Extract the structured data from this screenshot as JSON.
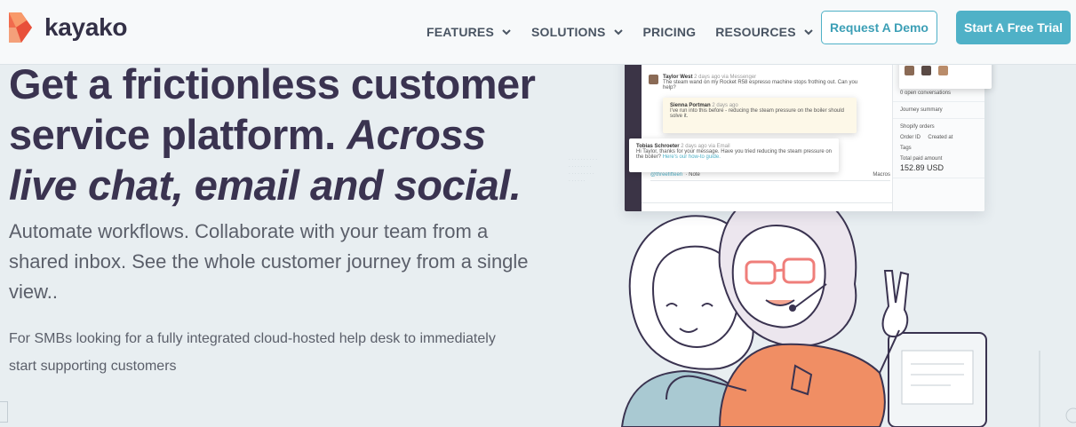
{
  "brand": {
    "name": "kayako"
  },
  "nav": {
    "items": [
      {
        "label": "FEATURES",
        "has_dropdown": true
      },
      {
        "label": "SOLUTIONS",
        "has_dropdown": true
      },
      {
        "label": "PRICING",
        "has_dropdown": false
      },
      {
        "label": "RESOURCES",
        "has_dropdown": true
      }
    ],
    "demo_button": "Request A Demo",
    "trial_button": "Start A Free Trial"
  },
  "hero": {
    "title_plain": "Get a frictionless customer service platform.",
    "title_italic": "Across live chat, email and social.",
    "subtitle": "Automate workflows. Collaborate with your team from a shared inbox. See the whole customer journey from a single view..",
    "note": "For SMBs looking for a fully integrated cloud-hosted help desk to immediately start supporting customers"
  },
  "mockup": {
    "msg1_name": "Taylor West",
    "msg1_meta": "2 days ago via Messenger",
    "msg1_text": "The steam wand on my Rocket R58 espresso machine stops frothing out. Can you help?",
    "msg2_name": "Sienna Portman",
    "msg2_meta": "2 days ago",
    "msg2_text": "I've run into this before - reducing the steam pressure on the boiler should solve it.",
    "msg3_name": "Tobias Schroeter",
    "msg3_meta": "2 days ago via Email",
    "msg3_text": "Hi Taylor, thanks for your message. Have you tried reducing the steam pressure on the boiler?",
    "msg3_link": "Here's our how-to guide.",
    "reply_handle": "@threefifteen",
    "reply_tab": "Note",
    "reply_channel": "Macros",
    "right_open": "0 open conversations",
    "right_journey": "Journey summary",
    "right_shopify": "Shopify orders",
    "right_order": "Order ID",
    "right_created": "Created at",
    "right_tags": "Tags",
    "right_total": "Total paid amount",
    "right_amount": "152.89 USD"
  },
  "colors": {
    "accent": "#4fb1c7",
    "title": "#3a3350",
    "shirt": "#f08e64",
    "background": "#e8eef1"
  }
}
